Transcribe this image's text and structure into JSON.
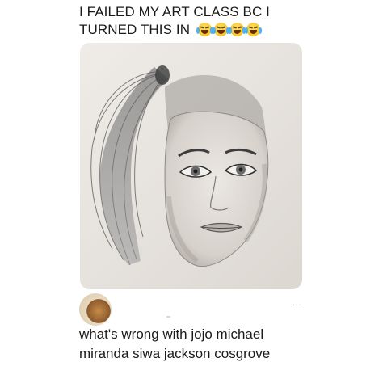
{
  "post": {
    "caption_line1": "I FAILED MY ART CLASS BC I",
    "caption_line2": "TURNED THIS IN",
    "emojis": [
      "crying-face",
      "crying-face",
      "crying-face",
      "crying-face"
    ]
  },
  "comment": {
    "more_label": "...",
    "line1": "what's wrong with jojo michael",
    "line2": "miranda siwa jackson cosgrove"
  },
  "colors": {
    "background": "#ffffff",
    "text": "#1a1a1a",
    "paper": "#e6e2dd"
  }
}
